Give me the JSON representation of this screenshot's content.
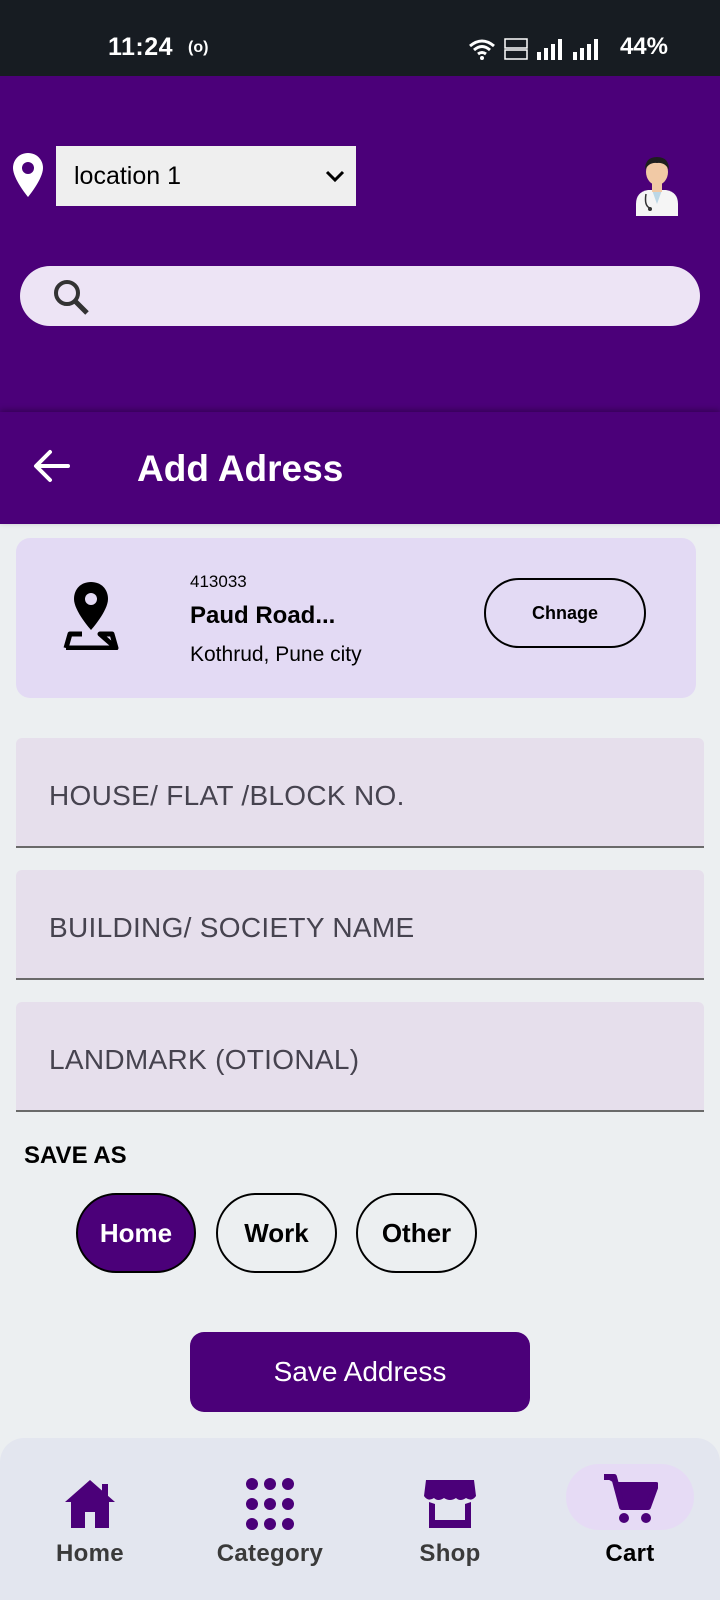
{
  "status_bar": {
    "time": "11:24",
    "cast_icon": "(o)",
    "battery": "44%",
    "icons": [
      "wifi-icon",
      "volte-icon",
      "signal-icon",
      "signal-icon"
    ]
  },
  "header": {
    "location_select": {
      "selected": "location 1"
    },
    "search": {
      "placeholder": ""
    }
  },
  "title_bar": {
    "title": "Add Adress"
  },
  "address_card": {
    "pin_code": "413033",
    "title": "Paud Road...",
    "subtitle": "Kothrud, Pune city",
    "change_label": "Chnage"
  },
  "form": {
    "house_placeholder": "HOUSE/ FLAT /BLOCK NO.",
    "building_placeholder": "BUILDING/ SOCIETY NAME",
    "landmark_placeholder": "LANDMARK (OTIONAL)"
  },
  "save_as": {
    "label": "SAVE AS",
    "options": [
      "Home",
      "Work",
      "Other"
    ],
    "selected": "Home"
  },
  "save_button": "Save Address",
  "bottom_nav": {
    "items": [
      {
        "label": "Home",
        "icon": "home-icon"
      },
      {
        "label": "Category",
        "icon": "grid-dots-icon"
      },
      {
        "label": "Shop",
        "icon": "store-icon"
      },
      {
        "label": "Cart",
        "icon": "cart-icon"
      }
    ],
    "active": "Cart"
  },
  "colors": {
    "primary": "#4b0079",
    "card": "#e3daf4",
    "field": "#e6dfec",
    "background": "#eceff1",
    "status_bar": "#171c22"
  }
}
